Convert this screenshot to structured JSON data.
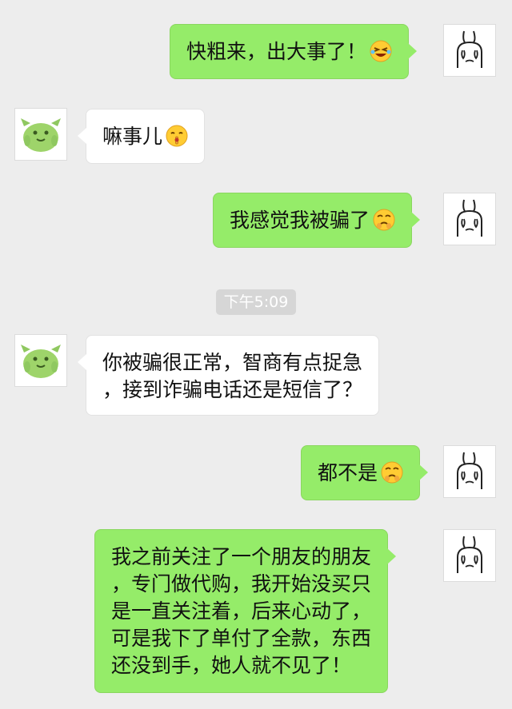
{
  "messages": [
    {
      "side": "me",
      "text": "快粗来，出大事了！",
      "emoji": "laughing-squint-emoji"
    },
    {
      "side": "them",
      "text": "嘛事儿",
      "emoji": "shush-emoji"
    },
    {
      "side": "me",
      "text": "我感觉我被骗了",
      "emoji": "pleading-emoji"
    },
    {
      "side": "them",
      "lines": [
        "你被骗很正常，智商有点捉急",
        "，接到诈骗电话还是短信了？"
      ]
    },
    {
      "side": "me",
      "text": "都不是",
      "emoji": "pleading-emoji"
    },
    {
      "side": "me",
      "lines": [
        "我之前关注了一个朋友的朋友",
        "，专门做代购，我开始没买只",
        "是一直关注着，后来心动了，",
        "可是我下了单付了全款，东西",
        "还没到手，她人就不见了！"
      ]
    }
  ],
  "timestamp": "下午5:09",
  "avatars": {
    "me": "rabbit-avatar-icon",
    "them": "green-creature-avatar-icon"
  },
  "colors": {
    "background": "#ededed",
    "me_bubble": "#95ec69",
    "them_bubble": "#ffffff",
    "timestamp_bg": "#d6d6d6"
  }
}
